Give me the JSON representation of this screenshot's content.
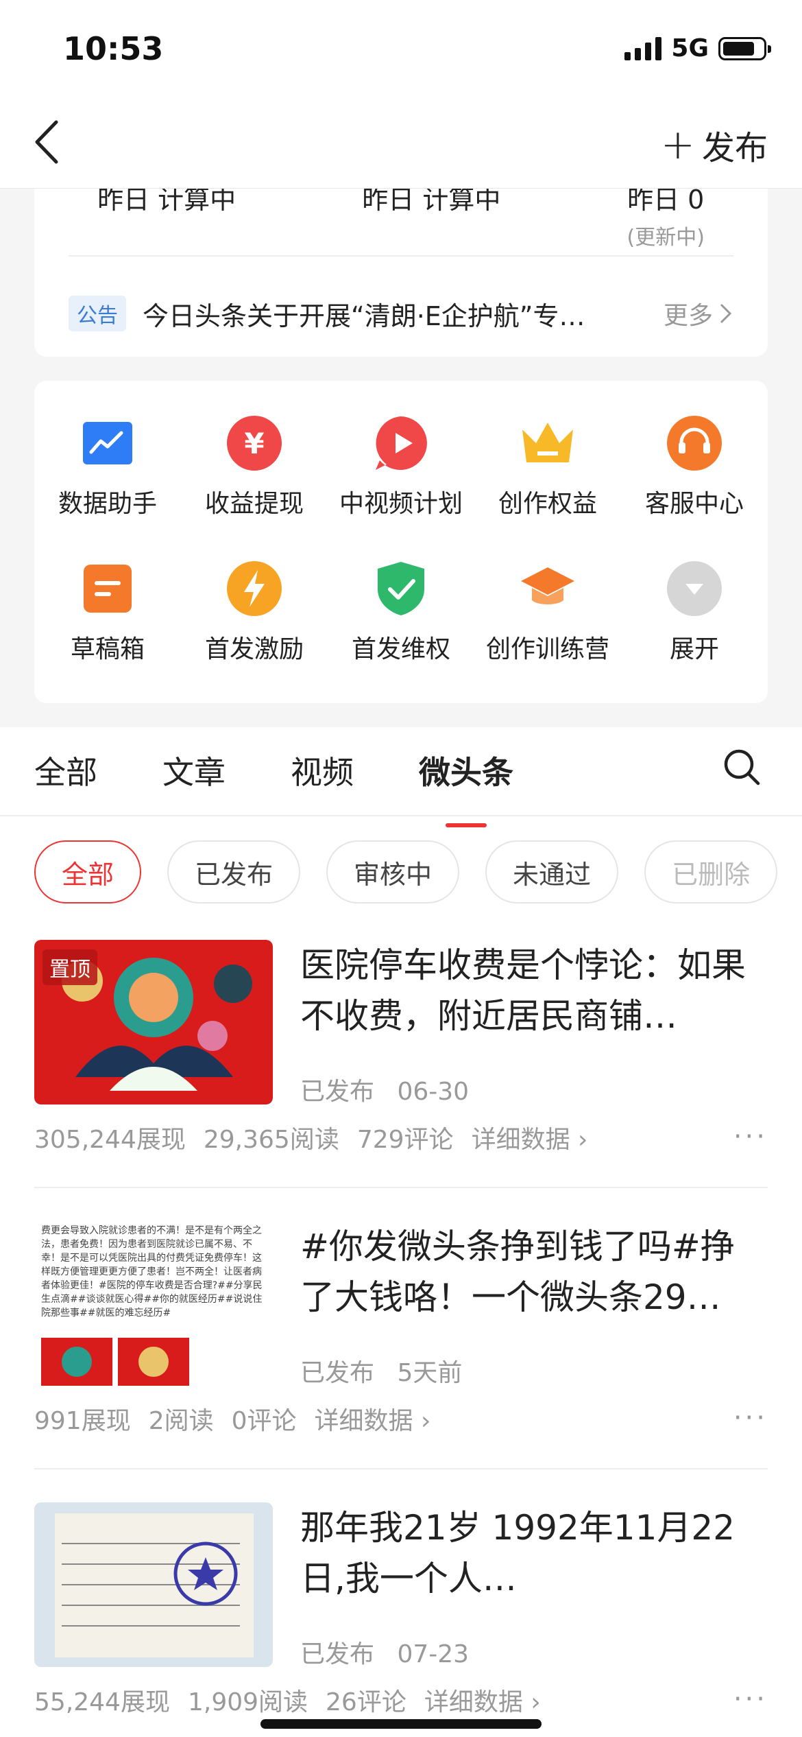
{
  "status": {
    "time": "10:53",
    "network": "5G"
  },
  "nav": {
    "publish_label": "发布"
  },
  "summary": {
    "stats": [
      {
        "value": "昨日 计算中",
        "sub": ""
      },
      {
        "value": "昨日 计算中",
        "sub": ""
      },
      {
        "value": "昨日 0",
        "sub": "(更新中)"
      }
    ],
    "notice_tag": "公告",
    "notice_text": "今日头条关于开展“清朗·E企护航”专…",
    "notice_more": "更多"
  },
  "tools": [
    {
      "label": "数据助手",
      "icon": "chart-icon",
      "color": "#2f7df6"
    },
    {
      "label": "收益提现",
      "icon": "yen-icon",
      "color": "#f04848"
    },
    {
      "label": "中视频计划",
      "icon": "play-icon",
      "color": "#f04848"
    },
    {
      "label": "创作权益",
      "icon": "crown-icon",
      "color": "#f7b928"
    },
    {
      "label": "客服中心",
      "icon": "headset-icon",
      "color": "#f5792a"
    },
    {
      "label": "草稿箱",
      "icon": "draft-icon",
      "color": "#f5792a"
    },
    {
      "label": "首发激励",
      "icon": "bolt-icon",
      "color": "#f7a424"
    },
    {
      "label": "首发维权",
      "icon": "shield-icon",
      "color": "#2db86b"
    },
    {
      "label": "创作训练营",
      "icon": "graduation-cap-icon",
      "color": "#f5792a"
    },
    {
      "label": "展开",
      "icon": "expand-icon",
      "color": "#d6d6d6"
    }
  ],
  "tabs": [
    "全部",
    "文章",
    "视频",
    "微头条"
  ],
  "active_tab": "微头条",
  "filters": [
    "全部",
    "已发布",
    "审核中",
    "未通过",
    "已删除"
  ],
  "posts": [
    {
      "pinned_label": "置顶",
      "title": "医院停车收费是个悖论：如果不收费，附近居民商铺…",
      "status": "已发布",
      "date": "06-30",
      "impressions": "305,244展现",
      "reads": "29,365阅读",
      "comments": "729评论",
      "detail": "详细数据"
    },
    {
      "title": "#你发微头条挣到钱了吗#挣了大钱咯！一个微头条29…",
      "status": "已发布",
      "date": "5天前",
      "impressions": "991展现",
      "reads": "2阅读",
      "comments": "0评论",
      "detail": "详细数据",
      "thumb_text": "费更会导致入院就诊患者的不满！是不是有个两全之法，患者免费！因为患者到医院就诊已属不易、不幸！是不是可以凭医院出具的付费凭证免费停车！这样既方便管理更更方便了患者！岂不两全！让医者病者体验更佳！#医院的停车收费是否合理?##分享民生点滴##谈谈就医心得##你的就医经历##说说住院那些事##就医的难忘经历#"
    },
    {
      "title": "那年我21岁 1992年11月22日,我一个人…",
      "status": "已发布",
      "date": "07-23",
      "impressions": "55,244展现",
      "reads": "1,909阅读",
      "comments": "26评论",
      "detail": "详细数据"
    }
  ]
}
